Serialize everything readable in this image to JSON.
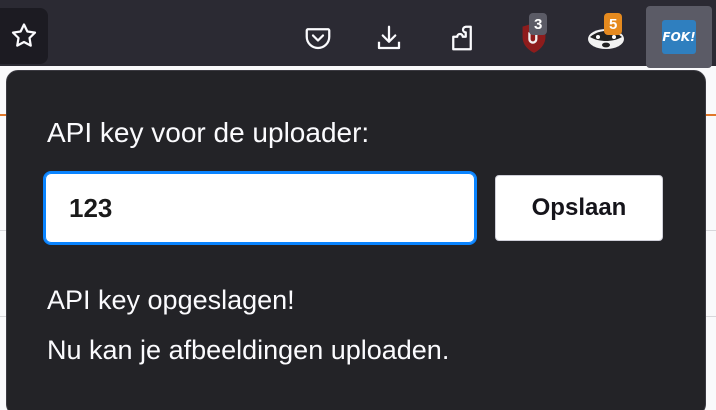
{
  "toolbar": {
    "icons": [
      "star-icon",
      "pocket-icon",
      "download-icon",
      "extensions-icon",
      "ublock-icon",
      "badger-icon",
      "fok-extension-icon"
    ],
    "ublock_badge": "3",
    "badger_badge": "5",
    "fok_logo_text": "FOK!"
  },
  "popup": {
    "label": "API key voor de uploader:",
    "api_key_value": "123",
    "save_button": "Opslaan",
    "status_line_1": "API key opgeslagen!",
    "status_line_2": "Nu kan je afbeeldingen uploaden."
  },
  "colors": {
    "toolbar_bg": "#2b2a33",
    "popup_bg": "#232327",
    "focus_ring": "#0a84ff",
    "badge_orange": "#e58a1f"
  }
}
